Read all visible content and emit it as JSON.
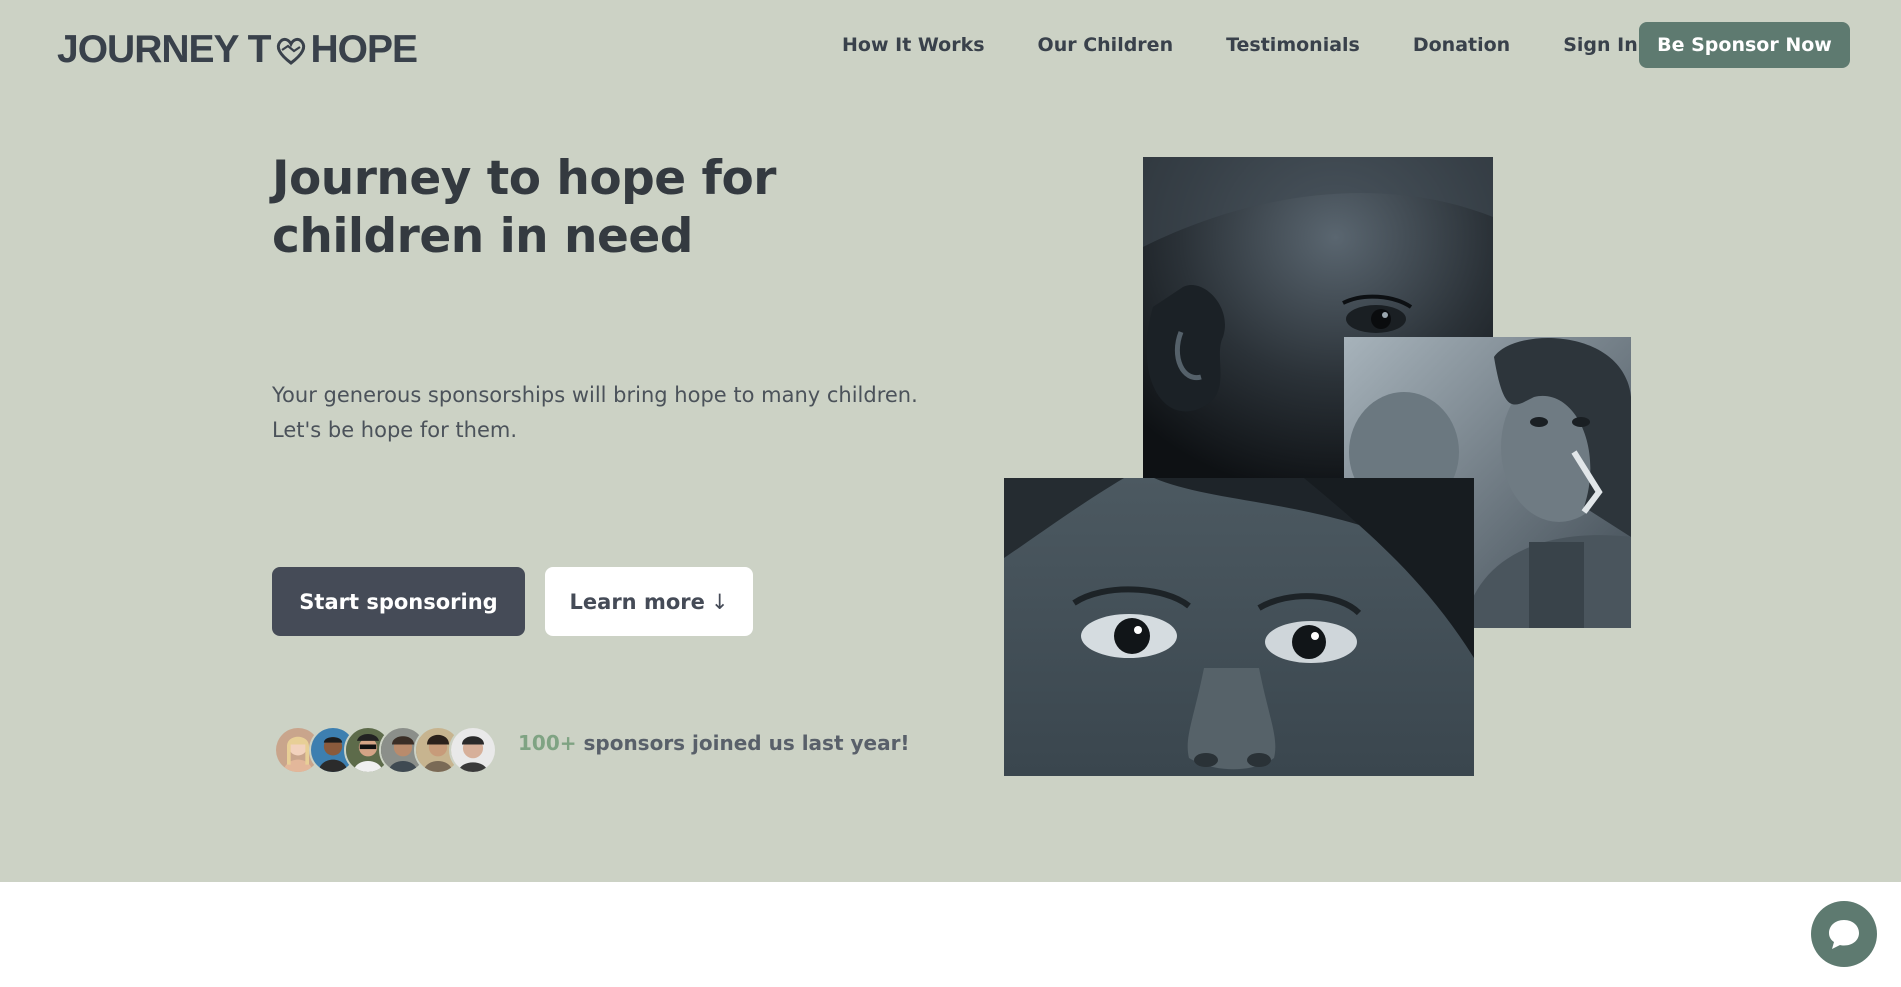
{
  "brand": {
    "logo_part1": "JOURNEY T",
    "logo_part2": "HOPE",
    "logo_heart_icon": "heart-hands-icon",
    "colors": {
      "hero_bg": "#ccd2c5",
      "accent": "#5e7a70",
      "dark_button": "#454b57",
      "count_green": "#7fa383"
    }
  },
  "nav": {
    "links": [
      "How It Works",
      "Our Children",
      "Testimonials",
      "Donation",
      "Sign In"
    ],
    "cta": "Be Sponsor Now"
  },
  "hero": {
    "title_line1": "Journey to hope for",
    "title_line2": "children in need",
    "subtitle_line1": "Your generous sponsorships will bring hope to many children.",
    "subtitle_line2": "Let's be hope for them.",
    "primary_button": "Start sponsoring",
    "secondary_button": "Learn more",
    "secondary_button_icon": "↓"
  },
  "sponsors": {
    "count": "100+",
    "text": " sponsors joined us last year!",
    "avatar_count": 6
  },
  "chat": {
    "icon": "chat-bubble-icon"
  }
}
